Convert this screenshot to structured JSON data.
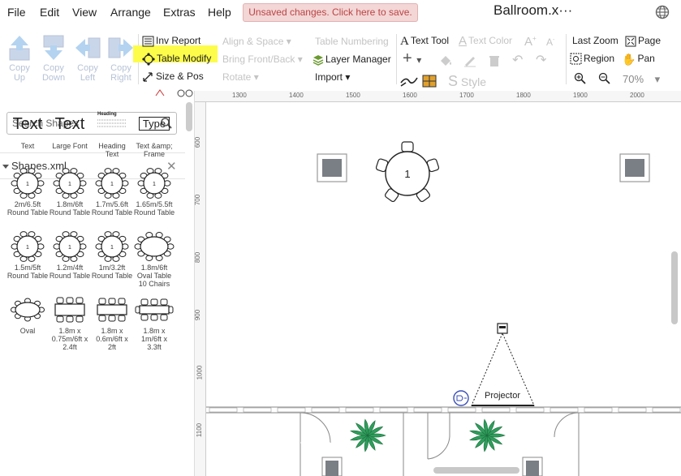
{
  "menu": [
    "File",
    "Edit",
    "View",
    "Arrange",
    "Extras",
    "Help"
  ],
  "unsaved_notice": "Unsaved changes. Click here to save.",
  "document_title": "Ballroom.x···",
  "toolbar": {
    "copy_up": [
      "Copy",
      "Up"
    ],
    "copy_down": [
      "Copy",
      "Down"
    ],
    "copy_left": [
      "Copy",
      "Left"
    ],
    "copy_right": [
      "Copy",
      "Right"
    ],
    "inv_report": "Inv Report",
    "table_modify": "Table Modify",
    "size_pos": "Size & Pos",
    "align_space": "Align & Space",
    "bring_front_back": "Bring Front/Back",
    "rotate": "Rotate",
    "table_numbering": "Table Numbering",
    "layer_manager": "Layer Manager",
    "import": "Import",
    "text_tool": "Text Tool",
    "text_color": "Text Color",
    "style": "Style",
    "last_zoom": "Last Zoom",
    "page": "Page",
    "region": "Region",
    "pan": "Pan",
    "zoom_level": "70%"
  },
  "search": {
    "placeholder": "Search Shapes"
  },
  "library": {
    "name": "Shapes.xml"
  },
  "shapes": [
    {
      "big": "Text",
      "label": "Text"
    },
    {
      "big": "Text",
      "label": "Large Font"
    },
    {
      "big": "Heading",
      "label": "Heading Text"
    },
    {
      "big": "Type",
      "label": "Text &amp; Frame"
    },
    {
      "label": "2m/6.5ft Round Table"
    },
    {
      "label": "1.8m/6ft Round Table"
    },
    {
      "label": "1.7m/5.6ft Round Table"
    },
    {
      "label": "1.65m/5.5ft Round Table"
    },
    {
      "label": "1.5m/5ft Round Table"
    },
    {
      "label": "1.2m/4ft Round Table"
    },
    {
      "label": "1m/3.2ft Round Table"
    },
    {
      "label": "1.8m/6ft Oval Table 10 Chairs"
    },
    {
      "label": "Oval"
    },
    {
      "label": "1.8m x 0.75m/6ft x 2.4ft"
    },
    {
      "label": "1.8m x 0.6m/6ft x 2ft"
    },
    {
      "label": "1.8m x 1m/6ft x 3.3ft"
    }
  ],
  "ruler_top": [
    "1300",
    "1400",
    "1500",
    "1600",
    "1700",
    "1800",
    "1900",
    "2000"
  ],
  "ruler_left": [
    "600",
    "700",
    "800",
    "900",
    "1000",
    "1100"
  ],
  "canvas": {
    "table_number": "1",
    "projector_label": "Projector"
  },
  "colors": {
    "highlight": "#fdfc4a",
    "unsaved_bg": "#f3d6d6",
    "plant": "#2e9e5b",
    "outlet": "#3a4fb8"
  }
}
